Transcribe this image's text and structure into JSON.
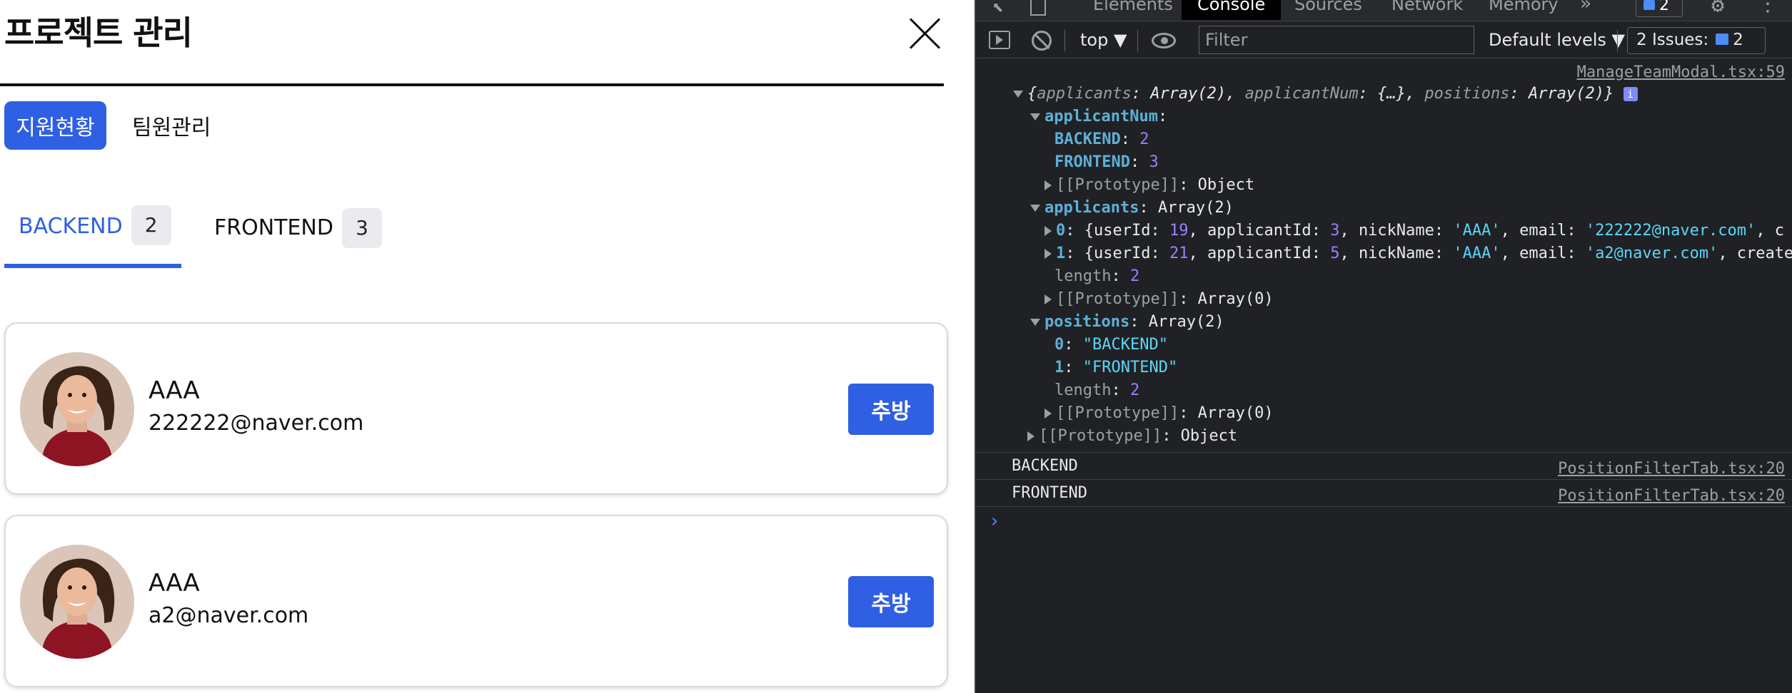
{
  "modal": {
    "title": "프로젝트 관리",
    "tabs": [
      {
        "label": "지원현황",
        "active": true
      },
      {
        "label": "팀원관리",
        "active": false
      }
    ],
    "position_tabs": [
      {
        "label": "BACKEND",
        "count": "2",
        "active": true
      },
      {
        "label": "FRONTEND",
        "count": "3",
        "active": false
      }
    ],
    "applicants": [
      {
        "name": "AAA",
        "email": "222222@naver.com",
        "action": "추방"
      },
      {
        "name": "AAA",
        "email": "a2@naver.com",
        "action": "추방"
      }
    ]
  },
  "devtools": {
    "tabs": [
      "Elements",
      "Console",
      "Sources",
      "Network",
      "Memory"
    ],
    "active_tab": "Console",
    "more": "»",
    "issue_badge": "2",
    "toolbar": {
      "context": "top ▼",
      "filter_placeholder": "Filter",
      "levels": "Default levels ▼",
      "issues": "2 Issues:",
      "issues_count": "2"
    },
    "console": {
      "source1": "ManageTeamModal.tsx:59",
      "obj_summary_pre": "{",
      "k_applicants": "applicants",
      "colon_array2": ": Array(2), ",
      "k_applicantNum": "applicantNum",
      "colon_obj": ": {…}, ",
      "k_positions": "positions",
      "colon_array2_close": ": Array(2)}",
      "info": "i",
      "applicantNum_label": "applicantNum",
      "colon": ":",
      "backend_key": "BACKEND",
      "backend_val": "2",
      "frontend_key": "FRONTEND",
      "frontend_val": "3",
      "proto_object": "[[Prototype]]",
      "object_word": ": Object",
      "applicants_label": "applicants",
      "applicants_type": ": Array(2)",
      "row0_idx": "0",
      "row0_a": ": {",
      "row0_userId": "userId",
      "row0_userId_val": "19",
      "row0_applicantId": "applicantId",
      "row0_applicantId_val": "3",
      "row0_nick": "nickName",
      "row0_nick_val": "'AAA'",
      "row0_email": "email",
      "row0_email_val": "'222222@naver.com'",
      "row0_tail": ", c",
      "row1_idx": "1",
      "row1_userId_val": "21",
      "row1_applicantId_val": "5",
      "row1_email_val": "'a2@naver.com'",
      "row1_tail": ", create",
      "length_key": "length",
      "length_val": "2",
      "proto_array": "[[Prototype]]",
      "array0_word": ": Array(0)",
      "positions_label": "positions",
      "positions_type": ": Array(2)",
      "pos0_idx": "0",
      "pos0_val": "\"BACKEND\"",
      "pos1_idx": "1",
      "pos1_val": "\"FRONTEND\"",
      "log1": "BACKEND",
      "log1_src": "PositionFilterTab.tsx:20",
      "log2": "FRONTEND",
      "log2_src": "PositionFilterTab.tsx:20",
      "prompt": "›"
    }
  }
}
